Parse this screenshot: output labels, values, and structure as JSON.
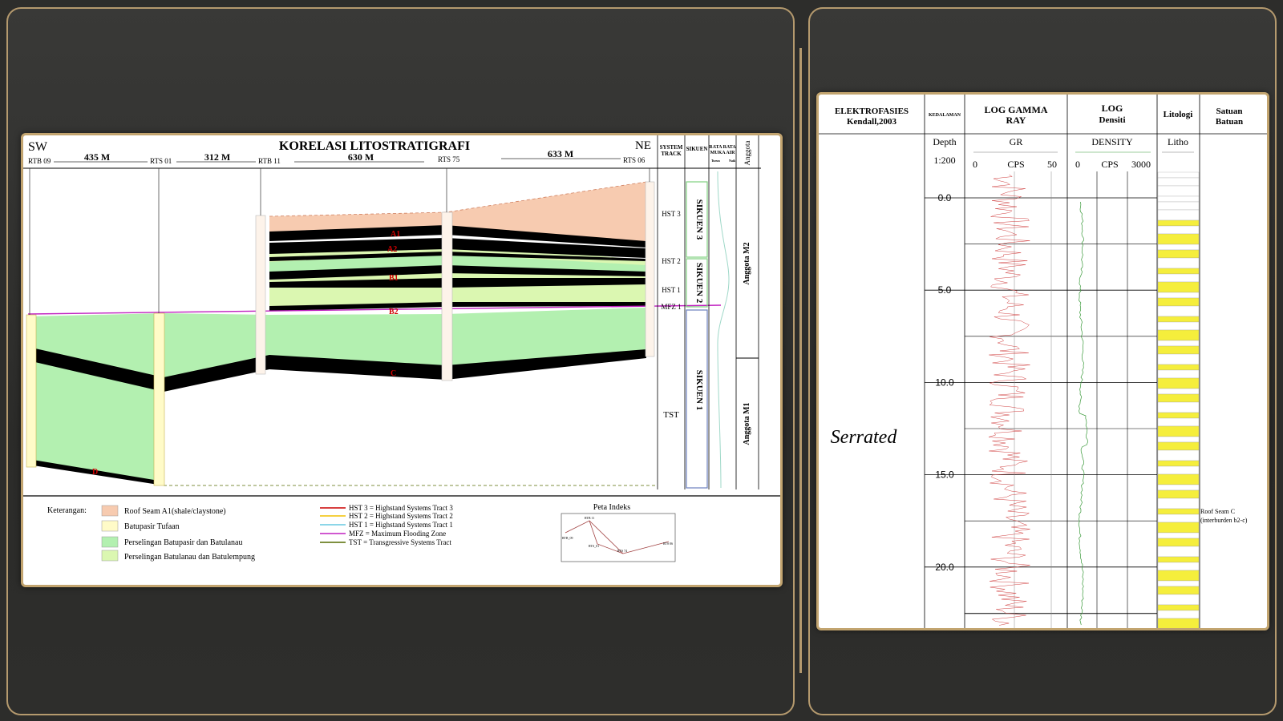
{
  "correlation": {
    "title": "KORELASI  LITOSTRATIGRAFI",
    "sw": "SW",
    "ne": "NE",
    "wells": [
      "RTB 09",
      "RTS 01",
      "RTB 11",
      "RTS 75",
      "RTS 06"
    ],
    "distances": [
      "435 M",
      "312 M",
      "630 M",
      "633 M"
    ],
    "columns": {
      "system_track_1": "SYSTEM",
      "system_track_2": "TRACK",
      "sikuen": "SIKUEN",
      "rata_1": "RATA RATA",
      "rata_2": "MUKA AIR",
      "turun": "Turun",
      "naik": "Naik",
      "anggota": "Anggota"
    },
    "tracts": [
      "HST 3",
      "HST 2",
      "HST 1",
      "MFZ 1",
      "TST"
    ],
    "sequences": [
      "SIKUEN 3",
      "SIKUEN 2",
      "SIKUEN 1"
    ],
    "members": [
      "Anggota M2",
      "Anggota M1"
    ],
    "seams": [
      "A1",
      "A2",
      "B1",
      "B2",
      "C",
      "D"
    ],
    "legend": {
      "keterangan": "Keterangan:",
      "facies": [
        {
          "label": "Roof Seam A1(shale/claystone)",
          "color": "#f7cbb0"
        },
        {
          "label": "Batupasir Tufaan",
          "color": "#fffbc8"
        },
        {
          "label": "Perselingan Batupasir dan Batulanau",
          "color": "#b3f0b0"
        },
        {
          "label": "Perselingan Batulanau dan Batulempung",
          "color": "#dbf7b1"
        }
      ],
      "tracts": [
        {
          "label": "HST 3 = Highstand Systems Tract 3",
          "color": "#cc0000"
        },
        {
          "label": "HST 2 = Highstand Systems Tract 2",
          "color": "#f2c000"
        },
        {
          "label": "HST 1 = Highstand Systems Tract 1",
          "color": "#66c8e0"
        },
        {
          "label": "MFZ  = Maximum Flooding Zone",
          "color": "#c020c0"
        },
        {
          "label": "TST  = Transgressive Systems Tract",
          "color": "#556b00"
        }
      ],
      "index_title": "Peta Indeks",
      "index_wells": [
        "RTB_09",
        "RTB 11",
        "RTS_01",
        "RTS 74",
        "RTS 06"
      ]
    }
  },
  "log": {
    "headers": {
      "elektrofasies": "ELEKTROFASIES",
      "kendall": "Kendall,2003",
      "kedalaman": "KEDALAMAN",
      "gamma_1": "LOG GAMMA",
      "gamma_2": "RAY",
      "dens_1": "LOG",
      "dens_2": "Densiti",
      "litologi": "Litologi",
      "satuan_1": "Satuan",
      "satuan_2": "Batuan"
    },
    "sub": {
      "depth": "Depth",
      "scale": "1:200",
      "gr": "GR",
      "gr_min": "0",
      "gr_unit": "CPS",
      "gr_max": "50",
      "density": "DENSITY",
      "den_min": "0",
      "den_unit": "CPS",
      "den_max": "3000",
      "litho": "Litho"
    },
    "depth_ticks": [
      "0.0",
      "5.0",
      "10.0",
      "15.0",
      "20.0"
    ],
    "facies_label": "Serrated",
    "annotation_1": "Roof Seam C",
    "annotation_2": "(interburden b2-c)",
    "colors": {
      "gr": "#d04040",
      "density": "#3a9a3a",
      "sand": "#f5ee3c"
    }
  }
}
